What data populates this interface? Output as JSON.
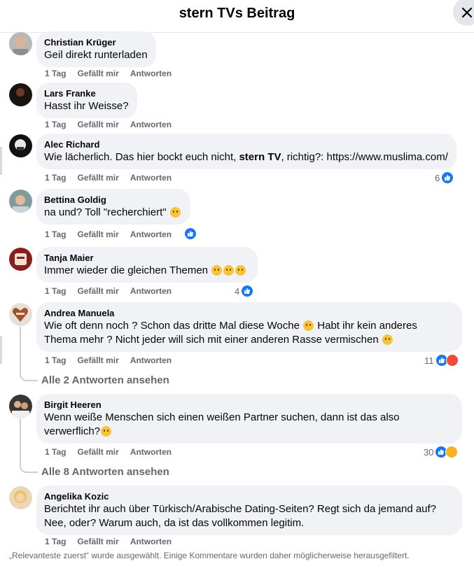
{
  "header": {
    "title": "stern TVs Beitrag"
  },
  "actions": {
    "time": "1 Tag",
    "like": "Gefällt mir",
    "reply": "Antworten"
  },
  "comments": [
    {
      "name": "Christian Krüger",
      "text": "Geil direkt runterladen"
    },
    {
      "name": "Lars Franke",
      "text": "Hasst ihr Weisse?"
    },
    {
      "name": "Alec Richard",
      "text_pre": "Wie lächerlich. Das hier bockt euch nicht, ",
      "text_bold": "stern TV",
      "text_post": ", richtig?: https://www.muslima.com/",
      "reactions": "6"
    },
    {
      "name": "Bettina Goldig",
      "text": "na und? Toll \"recherchiert\""
    },
    {
      "name": "Tanja Maier",
      "text": "Immer wieder die gleichen Themen",
      "reactions": "4"
    },
    {
      "name": "Andrea Manuela",
      "text_line1": "Wie oft denn noch ? Schon das dritte Mal diese Woche",
      "text_line1b": "Habt ihr kein anderes",
      "text_line2": "Thema mehr ? Nicht jeder will sich mit einer anderen Rasse vermischen",
      "reactions": "11",
      "replies_link": "Alle 2 Antworten ansehen"
    },
    {
      "name": "Birgit Heeren",
      "text_line1": "Wenn weiße Menschen sich einen weißen Partner suchen, dann ist das also",
      "text_line2": "verwerflich?",
      "reactions": "30",
      "replies_link": "Alle 8 Antworten ansehen"
    },
    {
      "name": "Angelika Kozic",
      "text_line1": "Berichtet ihr auch über Türkisch/Arabische Dating-Seiten? Regt sich da jemand auf?",
      "text_line2": "Nee, oder? Warum auch, da ist das vollkommen legitim."
    }
  ],
  "footer": "„Relevanteste zuerst“ wurde ausgewählt. Einige Kommentare wurden daher möglicherweise herausgefiltert.",
  "colors": {
    "like": "#1877f2",
    "angry": "#f04a3d",
    "haha": "#f7b125",
    "bubble": "#f0f2f5",
    "muted": "#65676b"
  }
}
